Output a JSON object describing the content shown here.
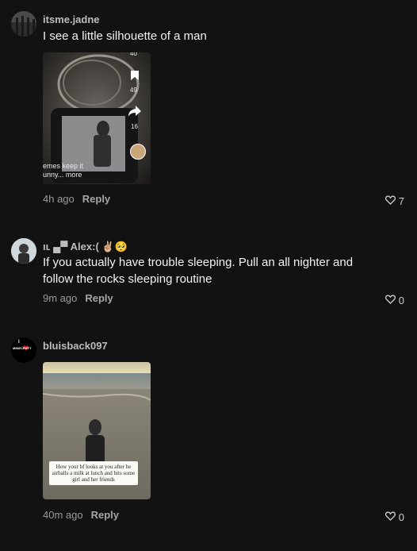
{
  "comments": [
    {
      "username": "itsme.jadne",
      "text": "I see a little silhouette of a man",
      "time": "4h ago",
      "reply_label": "Reply",
      "likes": "7",
      "thumbnail": {
        "overlay_top": "40",
        "bookmark_count": "49",
        "share_count": "16",
        "overlay_caption_line1": "emes keep it",
        "overlay_caption_line2": "unny... more"
      }
    },
    {
      "username": "ıʟ ▄▀ Alex:(",
      "username_emojis": "✌🏼🥺",
      "text_line1": "If you actually have trouble sleeping. Pull an all nighter and",
      "text_line2": "follow the rocks sleeping routine",
      "time": "9m ago",
      "reply_label": "Reply",
      "likes": "0"
    },
    {
      "username": "bluisback097",
      "avatar_text_top": "I",
      "avatar_text_bottom": "MINECRAFT",
      "time": "40m ago",
      "reply_label": "Reply",
      "likes": "0",
      "thumbnail": {
        "caption": "How your bf looks at you after he airballs a milk at lunch and hits some girl and her friends"
      }
    }
  ],
  "colors": {
    "background": "#121212",
    "text": "#f2f2f2",
    "muted": "#9a9a9a"
  }
}
